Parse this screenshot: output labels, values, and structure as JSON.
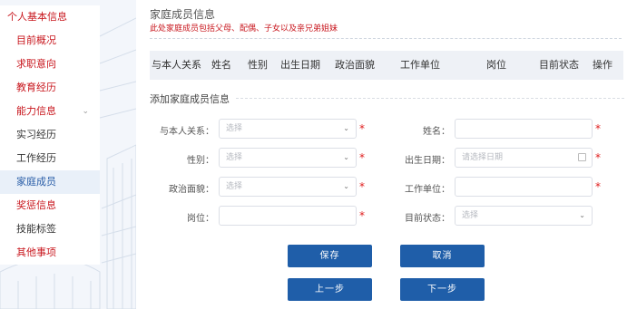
{
  "sidebar": {
    "items": [
      {
        "label": "个人基本信息"
      },
      {
        "label": "目前概况"
      },
      {
        "label": "求职意向"
      },
      {
        "label": "教育经历"
      },
      {
        "label": "能力信息"
      },
      {
        "label": "实习经历"
      },
      {
        "label": "工作经历"
      },
      {
        "label": "家庭成员"
      },
      {
        "label": "奖惩信息"
      },
      {
        "label": "技能标签"
      },
      {
        "label": "其他事项"
      }
    ]
  },
  "section": {
    "title": "家庭成员信息",
    "note": "此处家庭成员包括父母、配偶、子女以及亲兄弟姐妹"
  },
  "table": {
    "headers": [
      "与本人关系",
      "姓名",
      "性别",
      "出生日期",
      "政治面貌",
      "工作单位",
      "岗位",
      "目前状态",
      "操作"
    ]
  },
  "form": {
    "title": "添加家庭成员信息",
    "relation": {
      "label": "与本人关系：",
      "placeholder": "选择"
    },
    "name": {
      "label": "姓名：",
      "placeholder": ""
    },
    "gender": {
      "label": "性别：",
      "placeholder": "选择"
    },
    "birthdate": {
      "label": "出生日期：",
      "placeholder": "请选择日期"
    },
    "political": {
      "label": "政治面貌：",
      "placeholder": "选择"
    },
    "employer": {
      "label": "工作单位：",
      "placeholder": ""
    },
    "position": {
      "label": "岗位：",
      "placeholder": ""
    },
    "status": {
      "label": "目前状态：",
      "placeholder": "选择"
    },
    "required_mark": "*"
  },
  "buttons": {
    "save": "保存",
    "cancel": "取消",
    "prev": "上一步",
    "next": "下一步"
  },
  "colors": {
    "brand_blue": "#1f5ea9",
    "accent_red": "#c8161d",
    "required_red": "#e02020"
  }
}
